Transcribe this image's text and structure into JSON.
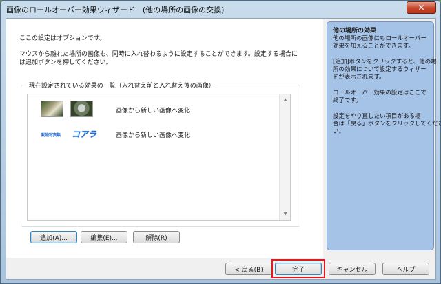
{
  "window": {
    "title": "画像のロールオーバー効果ウィザード　(他の場所の画像の交換)",
    "close_symbol": "✕"
  },
  "content": {
    "optional_note": "ここの設定はオプションです。",
    "description_lines": [
      "マウスから離れた場所の画像も、同時に入れ替わるように設定することができます。設定する場合に",
      "は追加ボタンを押してください。"
    ]
  },
  "effects": {
    "group_label": "現在設定されている効果の一覧（入れ替え前と入れ替え後の画像）",
    "items": [
      {
        "kind": "photo",
        "label": "画像から新しい画像へ変化"
      },
      {
        "kind": "text",
        "before_text": "動物写真集",
        "after_text": "コアラ",
        "label": "画像から新しい画像へ変化"
      }
    ],
    "scroll_up": "▲",
    "scroll_down": "▼",
    "add_label": "追加(A)...",
    "edit_label": "編集(E)...",
    "delete_label": "解除(R)"
  },
  "side_panel": {
    "title": "他の場所の効果",
    "lines": [
      "他の場所の画像にもロールオーバー",
      "効果を加えることができます。",
      "",
      "[追加]ボタンをクリックすると、他の場",
      "所の効果について設定するウィザー",
      "ドが表示されます。",
      "",
      "ロールオーバー効果の設定はここで",
      "終了です。",
      "",
      "設定をやり直したい項目がある場",
      "合は「戻る」ボタンをクリックしてくださ",
      "い。"
    ]
  },
  "footer": {
    "back_label": "< 戻る(B)",
    "finish_label": "完了",
    "cancel_label": "キャンセル",
    "help_label": "ヘルプ",
    "highlight_color": "#e21a1a"
  }
}
